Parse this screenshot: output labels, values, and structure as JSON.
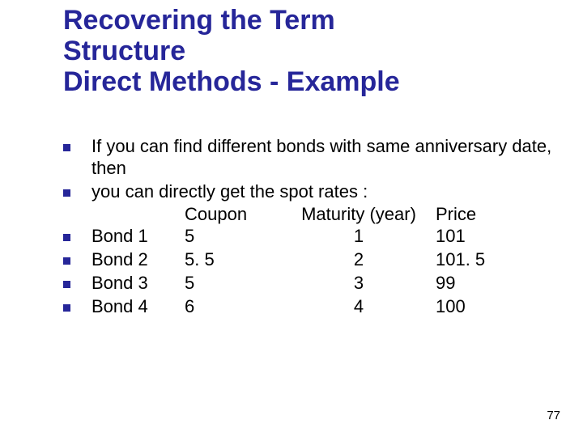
{
  "title": {
    "line1": "Recovering the Term",
    "line2": "Structure",
    "line3": "Direct Methods - Example"
  },
  "intro": {
    "line1": "If you can find different bonds with same anniversary date, then",
    "line2": "you can directly get the spot rates :"
  },
  "table": {
    "headers": {
      "coupon": "Coupon",
      "maturity": "Maturity (year)",
      "price": "Price"
    },
    "rows": [
      {
        "name": "Bond 1",
        "coupon": "5",
        "maturity": "1",
        "price": "101"
      },
      {
        "name": "Bond 2",
        "coupon": "5. 5",
        "maturity": "2",
        "price": "101. 5"
      },
      {
        "name": "Bond 3",
        "coupon": "5",
        "maturity": "3",
        "price": "99"
      },
      {
        "name": "Bond 4",
        "coupon": "6",
        "maturity": "4",
        "price": "100"
      }
    ]
  },
  "chart_data": {
    "type": "table",
    "title": "Bond data for recovering the term structure (direct method)",
    "columns": [
      "Bond",
      "Coupon",
      "Maturity (year)",
      "Price"
    ],
    "rows": [
      [
        "Bond 1",
        5,
        1,
        101
      ],
      [
        "Bond 2",
        5.5,
        2,
        101.5
      ],
      [
        "Bond 3",
        5,
        3,
        99
      ],
      [
        "Bond 4",
        6,
        4,
        100
      ]
    ]
  },
  "page_number": "77"
}
